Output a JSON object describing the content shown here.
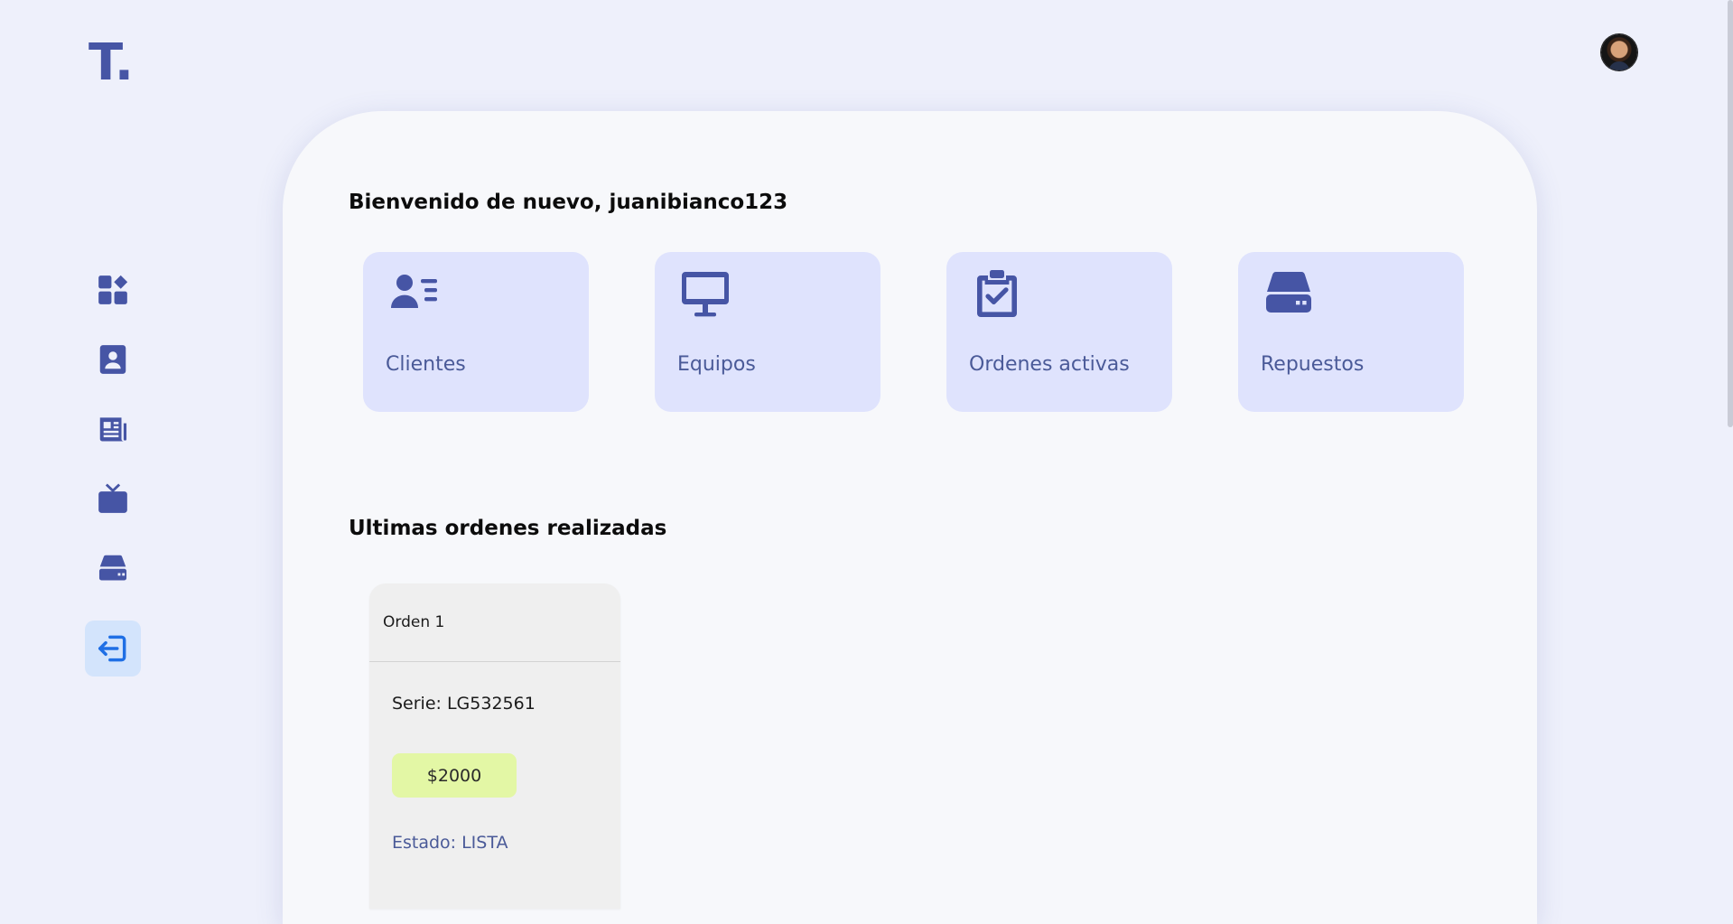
{
  "brand": {
    "logo_text": "T."
  },
  "user": {
    "avatar_alt": "juanibianco123"
  },
  "sidebar": {
    "items": [
      {
        "icon": "dashboard-icon"
      },
      {
        "icon": "contact-icon"
      },
      {
        "icon": "newspaper-icon"
      },
      {
        "icon": "tv-icon"
      },
      {
        "icon": "drive-icon"
      },
      {
        "icon": "logout-icon",
        "active": true
      }
    ]
  },
  "main": {
    "welcome": "Bienvenido de nuevo, juanibianco123",
    "cards": [
      {
        "label": "Clientes",
        "icon": "address-card-icon"
      },
      {
        "label": "Equipos",
        "icon": "desktop-icon"
      },
      {
        "label": "Ordenes activas",
        "icon": "clipboard-check-icon"
      },
      {
        "label": "Repuestos",
        "icon": "hard-drive-icon"
      }
    ],
    "recent_title": "Ultimas ordenes realizadas",
    "orders": [
      {
        "title": "Orden 1",
        "serie": "Serie: LG532561",
        "price": "$2000",
        "estado_label": "Estado:",
        "estado_value": "LISTA"
      }
    ]
  },
  "colors": {
    "accent": "#4655a5",
    "background": "#eef0fb",
    "card_bg": "#dfe3fd",
    "price_bg": "#e3f7a5",
    "active_item_bg": "#d3e4fc"
  }
}
